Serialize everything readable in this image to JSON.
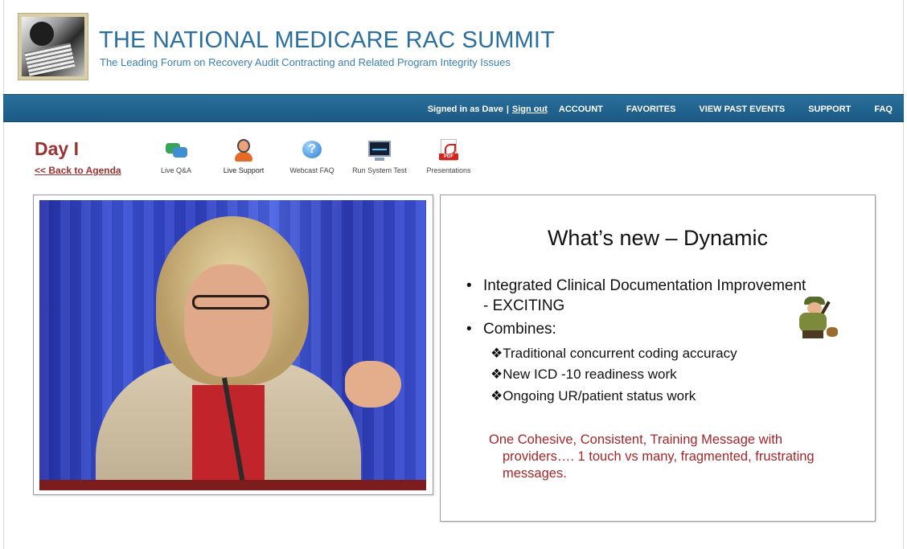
{
  "header": {
    "title": "THE NATIONAL MEDICARE RAC SUMMIT",
    "subtitle": "The Leading Forum on Recovery Audit Contracting and Related Program Integrity Issues"
  },
  "nav": {
    "signed_in_prefix": "Signed in as",
    "user": "Dave",
    "separator": "|",
    "sign_out": "Sign out",
    "links": [
      "ACCOUNT",
      "FAVORITES",
      "VIEW PAST EVENTS",
      "SUPPORT",
      "FAQ"
    ]
  },
  "day": {
    "title": "Day I",
    "back_link": "<< Back to Agenda"
  },
  "tools": [
    {
      "label": "Live Q&A",
      "icon": "chat-bubbles-icon"
    },
    {
      "label": "Live Support",
      "icon": "support-agent-icon"
    },
    {
      "label": "Webcast FAQ",
      "icon": "help-bubble-icon"
    },
    {
      "label": "Run System Test",
      "icon": "monitor-icon"
    },
    {
      "label": "Presentations",
      "icon": "pdf-icon"
    }
  ],
  "slide": {
    "title": "What’s new – Dynamic",
    "bullet_char": "•",
    "sub_bullet_char": "❖",
    "bullets": [
      "Integrated Clinical Documentation Improvement",
      "- EXCITING",
      "Combines:"
    ],
    "sub_bullets": [
      "Traditional concurrent coding accuracy",
      "New ICD -10 readiness work",
      "Ongoing UR/patient status work"
    ],
    "note_lines": [
      "One Cohesive, Consistent, Training Message with",
      "providers….  1 touch vs many, fragmented, frustrating",
      "messages."
    ],
    "note_color": "#a2262a"
  },
  "colors": {
    "title_blue": "#2a6f9f",
    "nav_bg": "#1f5f8b",
    "day_red": "#9b3131"
  }
}
